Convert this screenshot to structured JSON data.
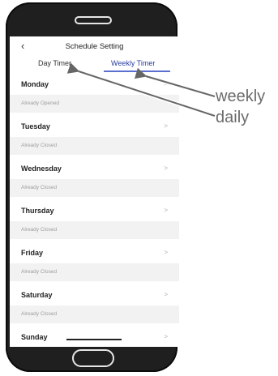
{
  "header": {
    "title": "Schedule Setting",
    "back_icon": "‹"
  },
  "tabs": [
    {
      "label": "Day Timer",
      "active": false
    },
    {
      "label": "Weekly Timer",
      "active": true
    }
  ],
  "days": [
    {
      "name": "Monday",
      "status": "Already Opened"
    },
    {
      "name": "Tuesday",
      "status": "Already Closed"
    },
    {
      "name": "Wednesday",
      "status": "Already Closed"
    },
    {
      "name": "Thursday",
      "status": "Already Closed"
    },
    {
      "name": "Friday",
      "status": "Already Closed"
    },
    {
      "name": "Saturday",
      "status": "Already Closed"
    },
    {
      "name": "Sunday",
      "status": ""
    }
  ],
  "chevron": ">",
  "annotations": {
    "weekly": "weekly",
    "daily": "daily"
  },
  "colors": {
    "accent": "#2a3e9f",
    "tab_underline": "#5a6fd0",
    "status_text": "#9d9d9d"
  }
}
